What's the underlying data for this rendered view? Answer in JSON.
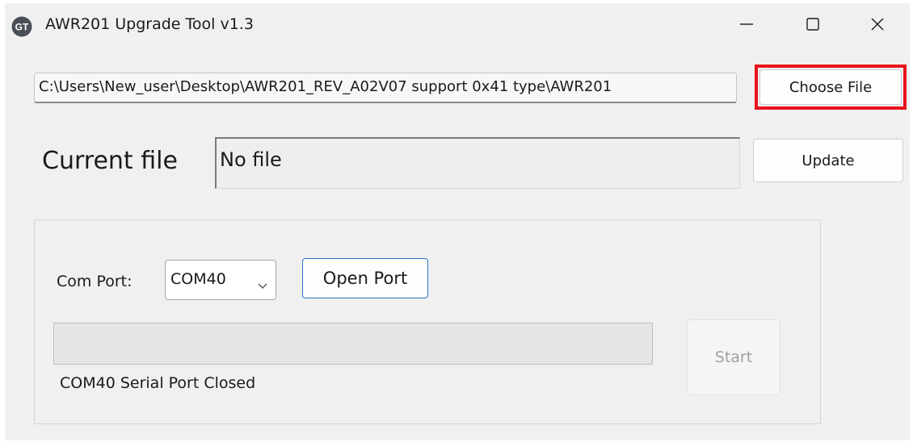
{
  "window": {
    "title": "AWR201 Upgrade Tool v1.3",
    "logo_text": "GT"
  },
  "file": {
    "path_value": "C:\\Users\\New_user\\Desktop\\AWR201_REV_A02V07 support 0x41 type\\AWR201",
    "choose_label": "Choose File",
    "current_label": "Current file",
    "current_value": "No file",
    "update_label": "Update"
  },
  "port": {
    "com_label": "Com Port:",
    "selected": "COM40",
    "open_label": "Open Port",
    "start_label": "Start",
    "progress": 0,
    "status": "COM40 Serial Port Closed"
  },
  "colors": {
    "highlight": "#e8141b",
    "focus_border": "#2e75cc"
  },
  "icons": {
    "minimize": "minimize-icon",
    "maximize": "maximize-icon",
    "close": "close-icon",
    "dropdown": "chevron-down-icon"
  }
}
